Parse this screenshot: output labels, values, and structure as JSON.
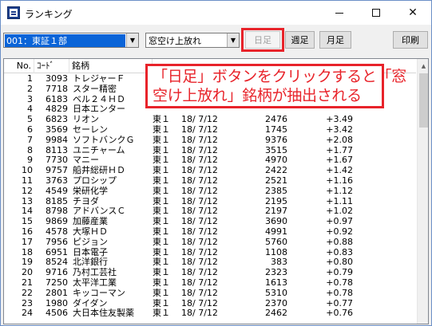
{
  "window": {
    "title": "ランキング",
    "minimize_glyph": "—",
    "maximize_glyph": "☐",
    "close_glyph": "✕"
  },
  "toolbar": {
    "market_value": "001：東証１部",
    "ranking_type_value": "窓空け上放れ",
    "day_label": "日足",
    "week_label": "週足",
    "month_label": "月足",
    "print_label": "印刷",
    "dropdown_glyph": "▼"
  },
  "table": {
    "columns": [
      "No.",
      "ｺｰﾄﾞ",
      "銘柄"
    ],
    "rows": [
      {
        "no": "1",
        "code": "3093",
        "name": "トレジャーＦ",
        "market": "",
        "date": "",
        "price": "",
        "change": ""
      },
      {
        "no": "2",
        "code": "7718",
        "name": "スター精密",
        "market": "",
        "date": "",
        "price": "",
        "change": ""
      },
      {
        "no": "3",
        "code": "6183",
        "name": "ベル２４ＨＤ",
        "market": "",
        "date": "",
        "price": "",
        "change": ""
      },
      {
        "no": "4",
        "code": "4829",
        "name": "日本エンター",
        "market": "",
        "date": "",
        "price": "",
        "change": ""
      },
      {
        "no": "5",
        "code": "6823",
        "name": "リオン",
        "market": "東１",
        "date": "18/ 7/12",
        "price": "2476",
        "change": "+3.49"
      },
      {
        "no": "6",
        "code": "3569",
        "name": "セーレン",
        "market": "東１",
        "date": "18/ 7/12",
        "price": "1745",
        "change": "+3.42"
      },
      {
        "no": "7",
        "code": "9984",
        "name": "ソフトバンクＧ",
        "market": "東１",
        "date": "18/ 7/12",
        "price": "9376",
        "change": "+2.08"
      },
      {
        "no": "8",
        "code": "8113",
        "name": "ユニチャーム",
        "market": "東１",
        "date": "18/ 7/12",
        "price": "3515",
        "change": "+1.77"
      },
      {
        "no": "9",
        "code": "7730",
        "name": "マニー",
        "market": "東１",
        "date": "18/ 7/12",
        "price": "4970",
        "change": "+1.67"
      },
      {
        "no": "10",
        "code": "9757",
        "name": "船井総研ＨＤ",
        "market": "東１",
        "date": "18/ 7/12",
        "price": "2422",
        "change": "+1.42"
      },
      {
        "no": "11",
        "code": "3763",
        "name": "プロシップ",
        "market": "東１",
        "date": "18/ 7/12",
        "price": "2521",
        "change": "+1.16"
      },
      {
        "no": "12",
        "code": "4549",
        "name": "栄研化学",
        "market": "東１",
        "date": "18/ 7/12",
        "price": "2385",
        "change": "+1.12"
      },
      {
        "no": "13",
        "code": "8185",
        "name": "チヨダ",
        "market": "東１",
        "date": "18/ 7/12",
        "price": "2195",
        "change": "+1.11"
      },
      {
        "no": "14",
        "code": "8798",
        "name": "アドバンスＣ",
        "market": "東１",
        "date": "18/ 7/12",
        "price": "2197",
        "change": "+1.02"
      },
      {
        "no": "15",
        "code": "9869",
        "name": "加藤産業",
        "market": "東１",
        "date": "18/ 7/12",
        "price": "3690",
        "change": "+0.97"
      },
      {
        "no": "16",
        "code": "4578",
        "name": "大塚ＨＤ",
        "market": "東１",
        "date": "18/ 7/12",
        "price": "4991",
        "change": "+0.92"
      },
      {
        "no": "17",
        "code": "7956",
        "name": "ピジョン",
        "market": "東１",
        "date": "18/ 7/12",
        "price": "5760",
        "change": "+0.88"
      },
      {
        "no": "18",
        "code": "6951",
        "name": "日本電子",
        "market": "東１",
        "date": "18/ 7/12",
        "price": "1108",
        "change": "+0.83"
      },
      {
        "no": "19",
        "code": "8524",
        "name": "北洋銀行",
        "market": "東１",
        "date": "18/ 7/12",
        "price": "383",
        "change": "+0.80"
      },
      {
        "no": "20",
        "code": "9716",
        "name": "乃村工芸社",
        "market": "東１",
        "date": "18/ 7/12",
        "price": "2323",
        "change": "+0.79"
      },
      {
        "no": "21",
        "code": "7250",
        "name": "太平洋工業",
        "market": "東１",
        "date": "18/ 7/12",
        "price": "1613",
        "change": "+0.78"
      },
      {
        "no": "22",
        "code": "2801",
        "name": "キッコーマン",
        "market": "東１",
        "date": "18/ 7/12",
        "price": "5310",
        "change": "+0.78"
      },
      {
        "no": "23",
        "code": "1980",
        "name": "ダイダン",
        "market": "東１",
        "date": "18/ 7/12",
        "price": "2370",
        "change": "+0.77"
      },
      {
        "no": "24",
        "code": "4506",
        "name": "大日本住友製薬",
        "market": "東１",
        "date": "18/ 7/12",
        "price": "2462",
        "change": "+0.76"
      }
    ]
  },
  "callout": {
    "line1": "「日足」ボタンをクリックすると「窓",
    "line2": "空け上放れ」銘柄が抽出される"
  },
  "colors": {
    "highlight": "#e8232a",
    "selection": "#0a64d8"
  }
}
